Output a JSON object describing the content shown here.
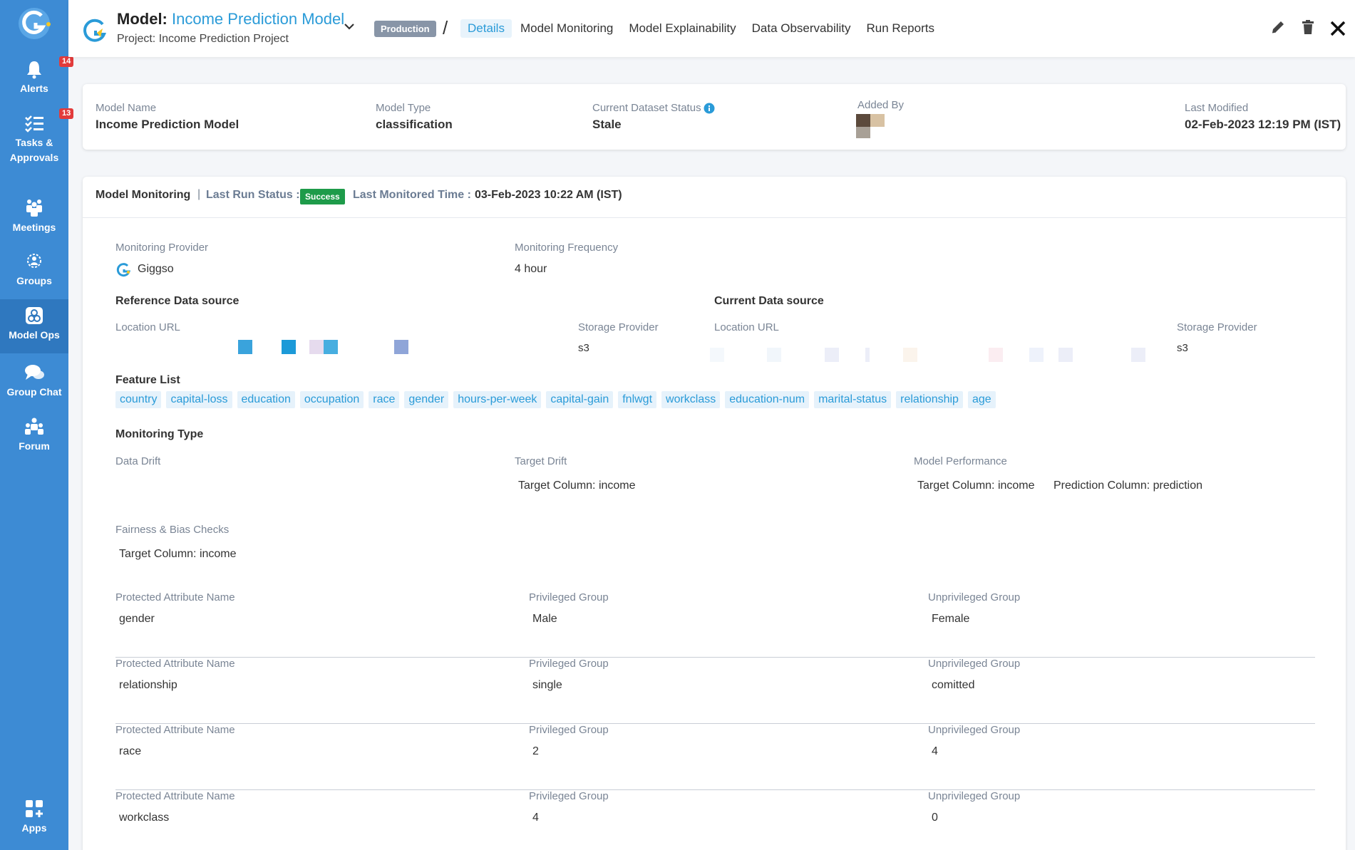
{
  "sidebar": {
    "items": [
      {
        "label": "Alerts",
        "icon": "bell-icon",
        "badge": "14"
      },
      {
        "label": "Tasks & Approvals",
        "icon": "tasks-icon",
        "badge": "13"
      },
      {
        "label": "Meetings",
        "icon": "meetings-icon",
        "badge": null
      },
      {
        "label": "Groups",
        "icon": "groups-icon",
        "badge": null
      },
      {
        "label": "Model Ops",
        "icon": "model-ops-icon",
        "badge": null
      },
      {
        "label": "Group Chat",
        "icon": "chat-icon",
        "badge": null
      },
      {
        "label": "Forum",
        "icon": "forum-icon",
        "badge": null
      },
      {
        "label": "Apps",
        "icon": "apps-icon",
        "badge": null
      }
    ]
  },
  "header": {
    "prefix": "Model:",
    "model_name": "Income Prediction Model",
    "project": "Project: Income Prediction Project",
    "environment": "Production",
    "tabs": [
      "Details",
      "Model Monitoring",
      "Model Explainability",
      "Data Observability",
      "Run Reports"
    ],
    "active_tab": "Details"
  },
  "summary": {
    "model_name_label": "Model Name",
    "model_name": "Income Prediction Model",
    "model_type_label": "Model Type",
    "model_type": "classification",
    "dataset_status_label": "Current Dataset Status",
    "dataset_status": "Stale",
    "added_by_label": "Added By",
    "last_modified_label": "Last Modified",
    "last_modified": "02-Feb-2023 12:19 PM (IST)"
  },
  "monitoring": {
    "title": "Model Monitoring",
    "separator": "|",
    "last_run_label": "Last Run Status :",
    "last_run_status": "Success",
    "last_monitored_label": "Last Monitored Time :",
    "last_monitored_time": "03-Feb-2023 10:22 AM (IST)",
    "provider_label": "Monitoring Provider",
    "provider": "Giggso",
    "frequency_label": "Monitoring Frequency",
    "frequency": "4 hour",
    "reference_title": "Reference Data source",
    "current_title": "Current Data source",
    "location_label": "Location URL",
    "storage_label": "Storage Provider",
    "reference_storage": "s3",
    "current_storage": "s3",
    "feature_list_title": "Feature List",
    "features": [
      "country",
      "capital-loss",
      "education",
      "occupation",
      "race",
      "gender",
      "hours-per-week",
      "capital-gain",
      "fnlwgt",
      "workclass",
      "education-num",
      "marital-status",
      "relationship",
      "age"
    ],
    "monitoring_type_title": "Monitoring Type",
    "data_drift_label": "Data Drift",
    "target_drift_label": "Target Drift",
    "target_drift_value": "Target Column: income",
    "model_perf_label": "Model Performance",
    "model_perf_target": "Target Column: income",
    "model_perf_prediction": "Prediction Column: prediction",
    "fairness_label": "Fairness & Bias Checks",
    "fairness_target": "Target Column: income",
    "protected_label": "Protected Attribute Name",
    "privileged_label": "Privileged Group",
    "unprivileged_label": "Unprivileged Group",
    "protected_rows": [
      {
        "attribute": "gender",
        "privileged": "Male",
        "unprivileged": "Female"
      },
      {
        "attribute": "relationship",
        "privileged": "single",
        "unprivileged": "comitted"
      },
      {
        "attribute": "race",
        "privileged": "2",
        "unprivileged": "4"
      },
      {
        "attribute": "workclass",
        "privileged": "4",
        "unprivileged": "0"
      }
    ]
  },
  "colors": {
    "sidebar": "#3d8bd4",
    "accent": "#2a9bd8",
    "success": "#1e9b4a",
    "badge": "#e23b3b"
  }
}
